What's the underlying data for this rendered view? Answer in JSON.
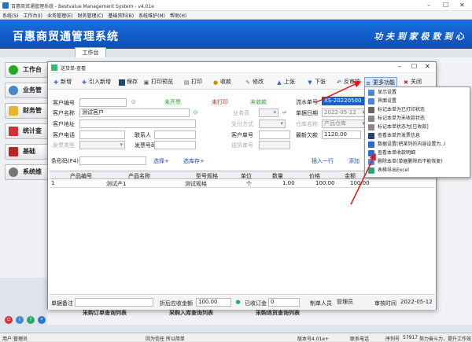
{
  "window": {
    "title": "百惠商贸通管理系统 - Bestvalue Management System - v4.01e",
    "controls": [
      "–",
      "☐",
      "✕"
    ]
  },
  "menubar": [
    "系统(S)",
    "工作台(I)",
    "业务管理(E)",
    "财务管理(C)",
    "基础资料(B)",
    "系统维护(M)",
    "帮助(H)"
  ],
  "banner": {
    "name": "百惠商贸通管理系统",
    "slogan": "功 夫 到 家  极 致 到 心"
  },
  "tab": "工作台",
  "leftnav": [
    "工作台",
    "业务管",
    "财务管",
    "统计查",
    "基础",
    "系统维"
  ],
  "background_buttons": [
    "采购订单查询列表",
    "采购入库查询列表",
    "采购退货查询列表"
  ],
  "dialog": {
    "title": "送货单-查看",
    "toolbar": [
      "新增",
      "引入新增",
      "保存",
      "打印预览",
      "打印",
      "收款",
      "修改",
      "上张",
      "下张",
      "反审核",
      "更多功能",
      "关闭"
    ],
    "status": {
      "unbilled": "未开票",
      "unprinted": "未打印",
      "unpaid": "未收款"
    },
    "fields": {
      "customer_no": {
        "label": "客户编号",
        "value": ""
      },
      "customer_name": {
        "label": "客户名称",
        "value": "测试客户"
      },
      "customer_addr": {
        "label": "客户地址",
        "value": ""
      },
      "customer_phone": {
        "label": "客户电话",
        "value": ""
      },
      "contact": {
        "label": "联系人",
        "value": ""
      },
      "invoice_type": {
        "label": "发票类型",
        "value": ""
      },
      "invoice_no": {
        "label": "发票号码",
        "value": ""
      },
      "salesman": {
        "label": "业务员",
        "value": ""
      },
      "pay_method": {
        "label": "支付方式",
        "value": ""
      },
      "customer_order": {
        "label": "客户单号",
        "value": ""
      },
      "delivery_no": {
        "label": "送货单号",
        "value": ""
      },
      "serial_no": {
        "label": "流水单号",
        "value": "XS-20220500"
      },
      "doc_date": {
        "label": "单据日期",
        "value": "2022-05-12"
      },
      "warehouse": {
        "label": "仓库名称",
        "value": "产品仓库"
      },
      "last_owed": {
        "label": "最新欠款",
        "value": "1120.00"
      },
      "barcode": {
        "label": "条形码(F4)",
        "value": ""
      }
    },
    "links": {
      "select": "选择+",
      "select_inv": "选库存+",
      "insert_row": "插入一行",
      "add": "添加"
    },
    "grid": {
      "columns": [
        "产品编号",
        "产品名称",
        "型号规格",
        "单位",
        "数量",
        "价格",
        "金额"
      ],
      "rows": [
        [
          "1",
          "",
          "测试产1",
          "测试规格",
          "个",
          "1.00",
          "100.00",
          "100.00"
        ]
      ]
    },
    "footer": {
      "remark_label": "单据备注",
      "remark": "",
      "rebate_label": "折后应收金额",
      "rebate": "100.00",
      "paid_label": "已收订金",
      "paid": "0",
      "creator_label": "制单人员",
      "creator": "管理员",
      "audit_label": "审核时间",
      "audit": "2022-05-12"
    }
  },
  "more_menu": [
    "显示设置",
    "界面设置",
    "标记本单为已打印状态",
    "标记本单为未收款状态",
    "标记本单状态为[已收款]",
    "查看本单开发票信息",
    "数据设置(把某列的内容设置为..)",
    "查看本单收款明细",
    "删除本单(单据删除后不能恢复)",
    "表格导出Excel"
  ],
  "statusbar": {
    "user": "用户:管理员",
    "company": "因为信任 所以简单",
    "version": "版本号4.01e+",
    "phone": "联系电话",
    "serial_label": "序列号",
    "serial": "57917",
    "motto": "努力奋斗力，提升工作效"
  },
  "colors": {
    "banner": "#0b4fb5",
    "accent_red": "#d22",
    "accent_green": "#2a2",
    "highlight": "#1d5fc4"
  }
}
